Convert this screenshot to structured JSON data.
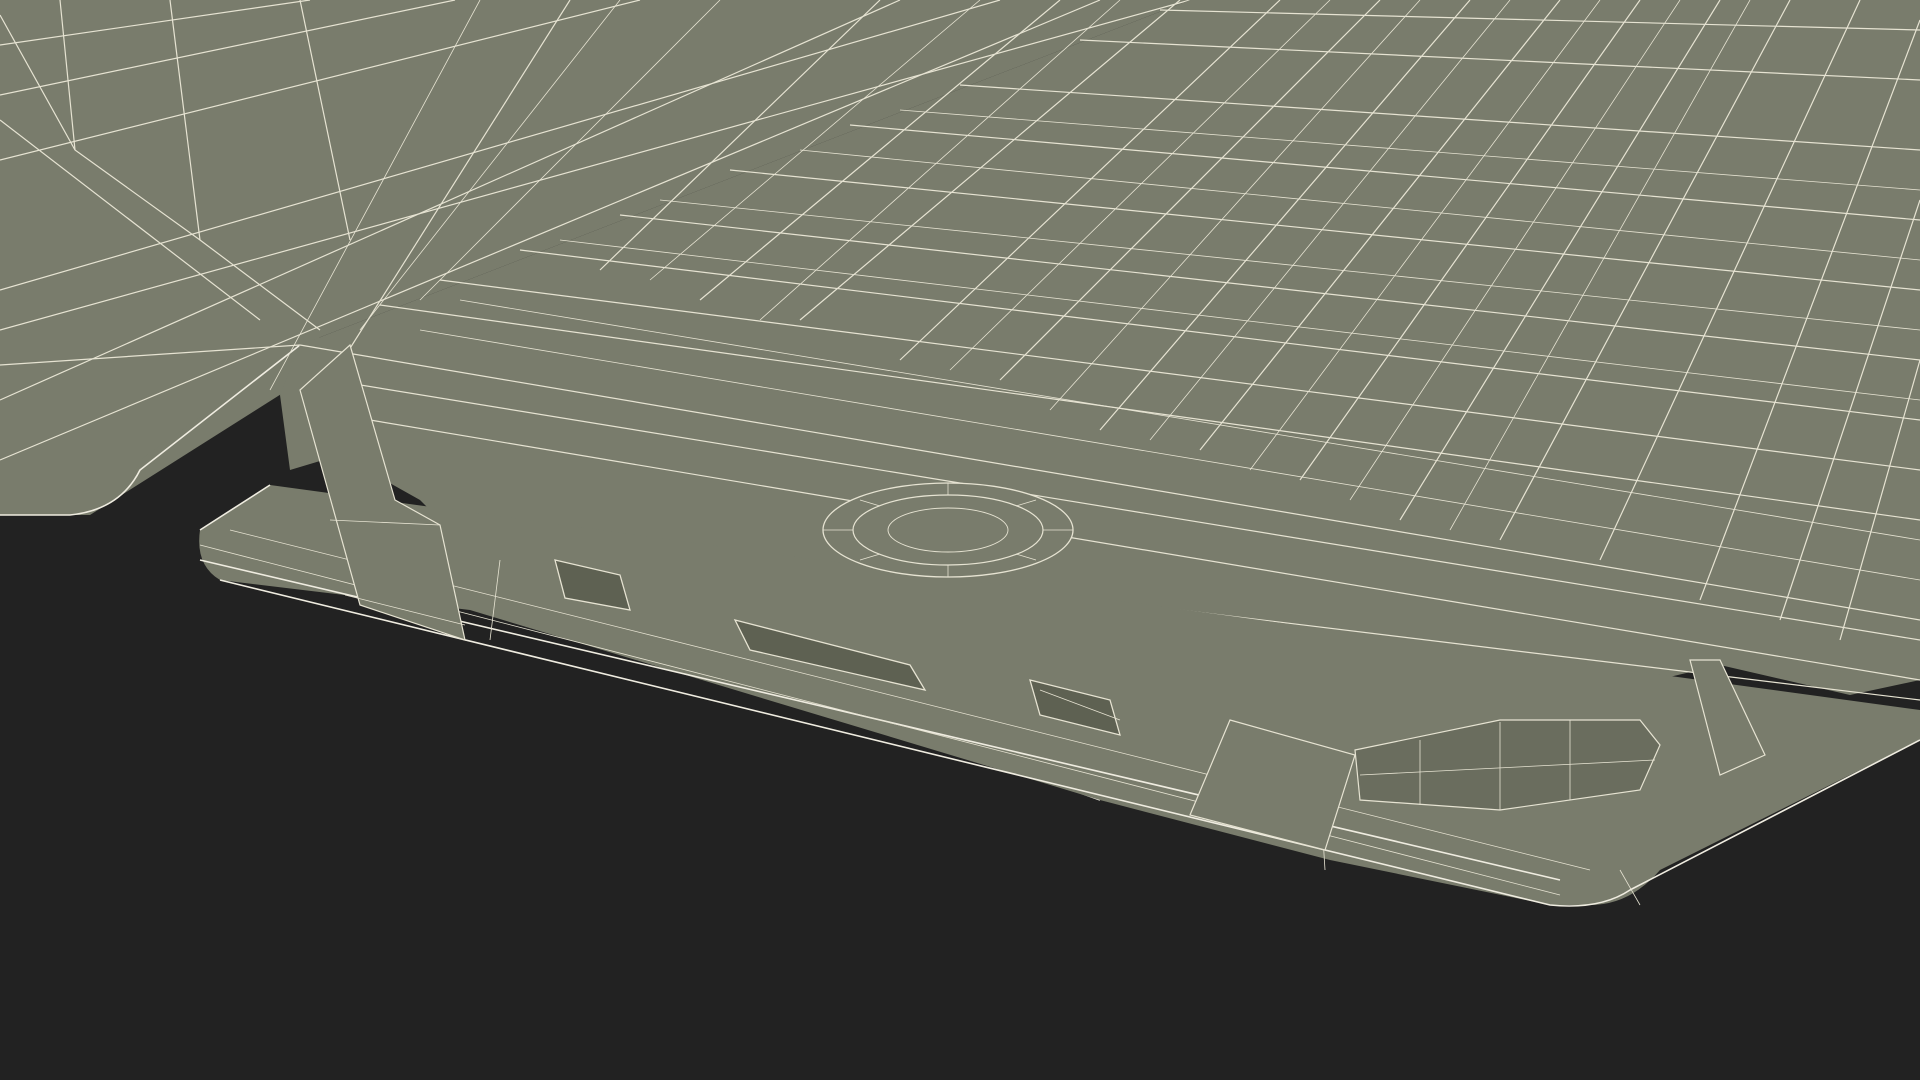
{
  "scene": {
    "background_color": "#222222",
    "model_color": "#797c6c",
    "model_shade_color": "#6a6d5e",
    "wire_color": "#e6e3d2"
  }
}
